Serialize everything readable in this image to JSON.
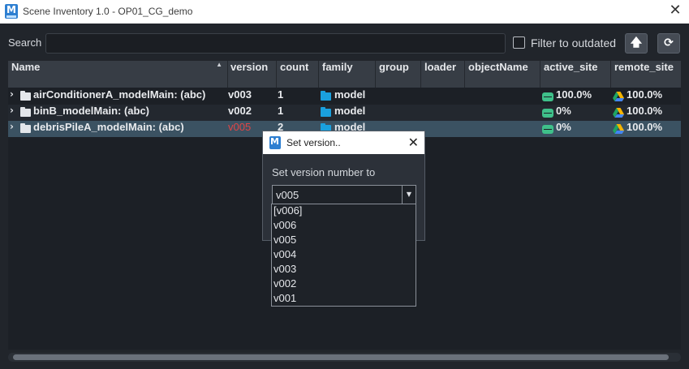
{
  "window": {
    "title": "Scene Inventory 1.0 - OP01_CG_demo",
    "close_glyph": "✕"
  },
  "search": {
    "label": "Search",
    "value": ""
  },
  "filter": {
    "label": "Filter to outdated",
    "checked": false
  },
  "toolbar": {
    "up_glyph": "🡅",
    "refresh_glyph": "⟳"
  },
  "table": {
    "columns": [
      "Name",
      "version",
      "count",
      "family",
      "group",
      "loader",
      "objectName",
      "active_site",
      "remote_site"
    ],
    "sort_glyph": "▲",
    "rows": [
      {
        "name": "airConditionerA_modelMain: (abc)",
        "version": "v003",
        "count": "1",
        "family": "model",
        "active_site": "100.0%",
        "remote_site": "100.0%",
        "outdated": false
      },
      {
        "name": "binB_modelMain: (abc)",
        "version": "v002",
        "count": "1",
        "family": "model",
        "active_site": "0%",
        "remote_site": "100.0%",
        "outdated": false
      },
      {
        "name": "debrisPileA_modelMain: (abc)",
        "version": "v005",
        "count": "2",
        "family": "model",
        "active_site": "0%",
        "remote_site": "100.0%",
        "outdated": true
      }
    ]
  },
  "dialog": {
    "title": "Set version..",
    "close_glyph": "✕",
    "label": "Set version number to",
    "selected": "v005",
    "options": [
      "[v006]",
      "v006",
      "v005",
      "v004",
      "v003",
      "v002",
      "v001"
    ]
  },
  "colors": {
    "accent": "#1aa0de",
    "outdated": "#e04545",
    "active_site": "#3fc08a",
    "selected_row": "#3b5262"
  }
}
